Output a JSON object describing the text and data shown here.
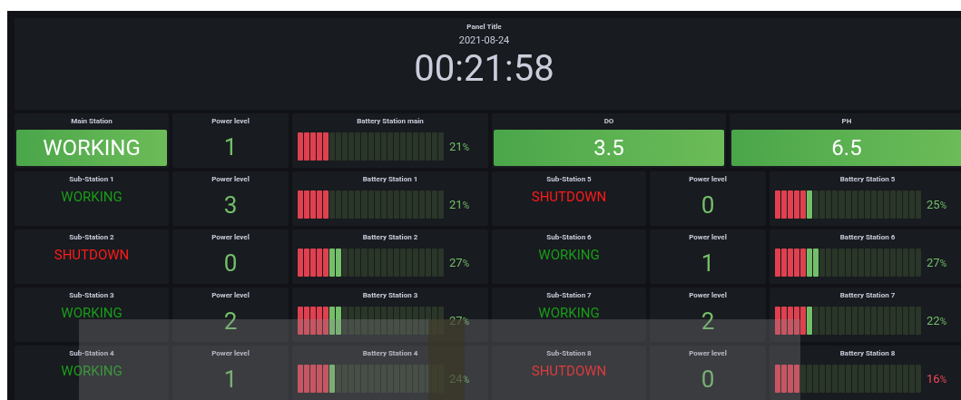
{
  "header": {
    "title": "Panel Title",
    "date": "2021-08-24",
    "time": "00:21:58"
  },
  "main_row": {
    "station": {
      "title": "Main Station",
      "status": "WORKING",
      "kind": "working"
    },
    "power": {
      "title": "Power level",
      "value": "1"
    },
    "battery": {
      "title": "Battery Station main",
      "level": 0.21,
      "reading": "21",
      "unit": "%"
    },
    "gauges": [
      {
        "title": "DO",
        "value": "3.5"
      },
      {
        "title": "PH",
        "value": "6.5"
      }
    ]
  },
  "rows": [
    {
      "groups": [
        {
          "station": {
            "title": "Sub-Station 1",
            "status": "WORKING",
            "kind": "working"
          },
          "power": {
            "title": "Power level",
            "value": "3"
          },
          "battery": {
            "title": "Battery Station 1",
            "level": 0.21,
            "reading": "21",
            "unit": "%"
          }
        },
        {
          "station": {
            "title": "Sub-Station 5",
            "status": "SHUTDOWN",
            "kind": "shutdown"
          },
          "power": {
            "title": "Power level",
            "value": "0"
          },
          "battery": {
            "title": "Battery Station 5",
            "level": 0.25,
            "reading": "25",
            "unit": "%"
          }
        }
      ]
    },
    {
      "groups": [
        {
          "station": {
            "title": "Sub-Station 2",
            "status": "SHUTDOWN",
            "kind": "shutdown"
          },
          "power": {
            "title": "Power level",
            "value": "0"
          },
          "battery": {
            "title": "Battery Station 2",
            "level": 0.27,
            "reading": "27",
            "unit": "%"
          }
        },
        {
          "station": {
            "title": "Sub-Station 6",
            "status": "WORKING",
            "kind": "working"
          },
          "power": {
            "title": "Power level",
            "value": "1"
          },
          "battery": {
            "title": "Battery Station 6",
            "level": 0.27,
            "reading": "27",
            "unit": "%"
          }
        }
      ]
    },
    {
      "groups": [
        {
          "station": {
            "title": "Sub-Station 3",
            "status": "WORKING",
            "kind": "working"
          },
          "power": {
            "title": "Power level",
            "value": "2"
          },
          "battery": {
            "title": "Battery Station 3",
            "level": 0.27,
            "reading": "27",
            "unit": "%"
          }
        },
        {
          "station": {
            "title": "Sub-Station 7",
            "status": "WORKING",
            "kind": "working"
          },
          "power": {
            "title": "Power level",
            "value": "2"
          },
          "battery": {
            "title": "Battery Station 7",
            "level": 0.22,
            "reading": "22",
            "unit": "%"
          }
        }
      ]
    },
    {
      "groups": [
        {
          "station": {
            "title": "Sub-Station 4",
            "status": "WORKING",
            "kind": "working"
          },
          "power": {
            "title": "Power level",
            "value": "1"
          },
          "battery": {
            "title": "Battery Station 4",
            "level": 0.24,
            "reading": "24",
            "unit": "%"
          }
        },
        {
          "station": {
            "title": "Sub-Station 8",
            "status": "SHUTDOWN",
            "kind": "shutdown"
          },
          "power": {
            "title": "Power level",
            "value": "0"
          },
          "battery": {
            "title": "Battery Station 8",
            "level": 0.16,
            "reading": "16",
            "unit": "%"
          }
        }
      ]
    }
  ]
}
